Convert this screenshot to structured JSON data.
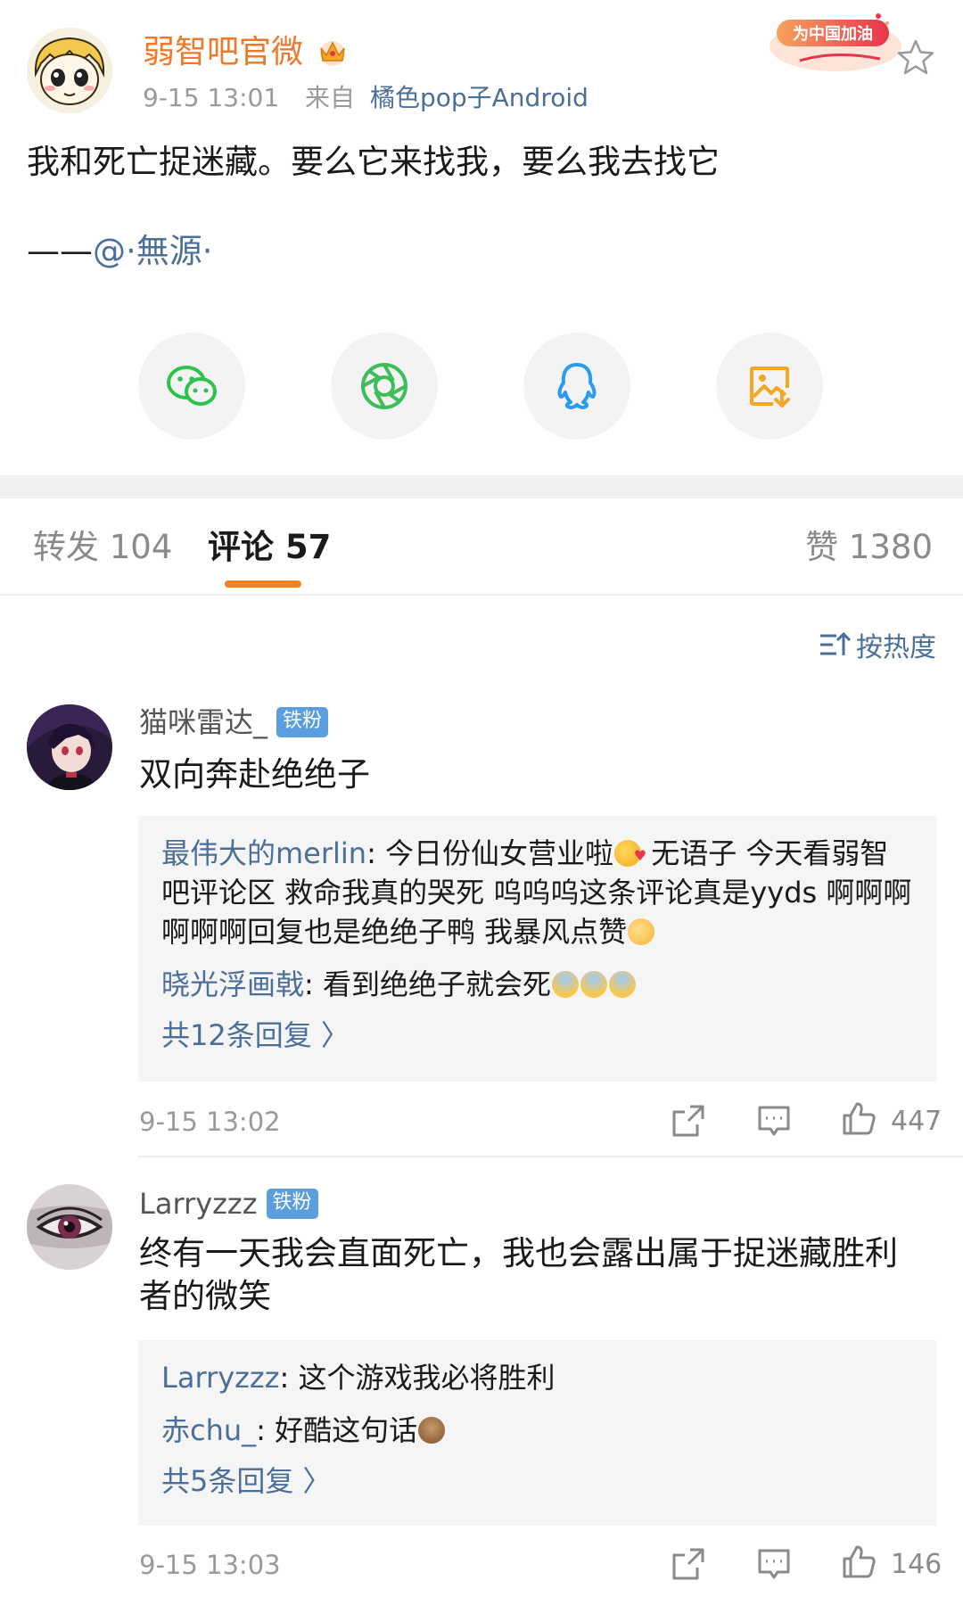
{
  "post": {
    "author": "弱智吧官微",
    "time": "9-15 13:01",
    "source_prefix": "来自",
    "source": "橘色pop子Android",
    "campaign_badge": "为中国加油",
    "text": "我和死亡捉迷藏。要么它来找我，要么我去找它",
    "attribution_prefix": "——",
    "attribution_mention": "@·無源·"
  },
  "share": [
    {
      "name": "wechat-icon",
      "color": "#2dc14d"
    },
    {
      "name": "moments-icon",
      "color": "#3ebd5b"
    },
    {
      "name": "qq-icon",
      "color": "#2a9bef"
    },
    {
      "name": "save-image-icon",
      "color": "#f5a623"
    }
  ],
  "tabs": {
    "repost": "转发 104",
    "comments": "评论 57",
    "likes": "赞 1380"
  },
  "sort_label": "按热度",
  "colors": {
    "accent": "#f58220",
    "link": "#4b6f99",
    "author": "#f0782a",
    "badge": "#5b9ee0"
  },
  "comments": [
    {
      "user": "猫咪雷达_",
      "badge": "铁粉",
      "text": "双向奔赴绝绝子",
      "replies": [
        {
          "author": "最伟大的merlin",
          "text": ": 今日份仙女营业啦",
          "text2": " 无语子 今天看弱智吧评论区 救命我真的哭死 呜呜呜这条评论真是yyds 啊啊啊啊啊啊回复也是绝绝子鸭 我暴风点赞"
        },
        {
          "author": "晓光浮画戟",
          "text": ": 看到绝绝子就会死"
        }
      ],
      "more": "共12条回复 〉",
      "time": "9-15 13:02",
      "likes": "447"
    },
    {
      "user": "Larryzzz",
      "badge": "铁粉",
      "text": "终有一天我会直面死亡，我也会露出属于捉迷藏胜利者的微笑",
      "replies": [
        {
          "author": "Larryzzz",
          "text": ": 这个游戏我必将胜利"
        },
        {
          "author": "赤chu_",
          "text": ": 好酷这句话"
        }
      ],
      "more": "共5条回复 〉",
      "time": "9-15 13:03",
      "likes": "146"
    }
  ]
}
